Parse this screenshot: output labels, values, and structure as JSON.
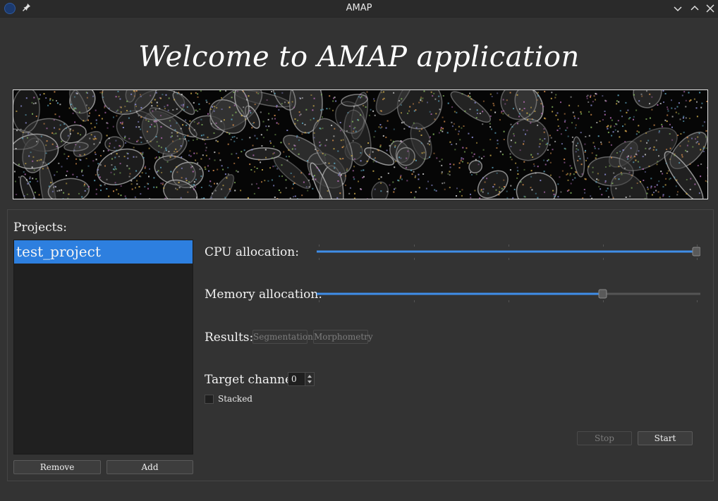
{
  "window": {
    "title": "AMAP"
  },
  "welcome": "Welcome to AMAP application",
  "projects": {
    "label": "Projects:",
    "items": [
      "test_project"
    ],
    "remove_label": "Remove",
    "add_label": "Add"
  },
  "settings": {
    "cpu_label": "CPU allocation:",
    "cpu_value": 1.0,
    "memory_label": "Memory allocation:",
    "memory_value": 0.74,
    "results_label": "Results:",
    "segmentation_label": "Segmentation",
    "morphometry_label": "Morphometry",
    "target_channel_label": "Target channel",
    "target_channel_value": "0",
    "stacked_label": "Stacked",
    "stacked_checked": false
  },
  "actions": {
    "stop_label": "Stop",
    "start_label": "Start"
  },
  "colors": {
    "accent": "#2d7fdf",
    "background": "#333333"
  },
  "icons": [
    "app-icon",
    "pin-icon",
    "minimize-icon",
    "maximize-icon",
    "close-icon"
  ]
}
